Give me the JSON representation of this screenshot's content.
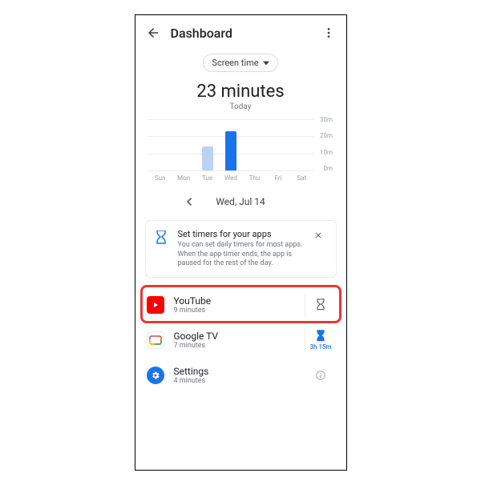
{
  "header": {
    "title": "Dashboard"
  },
  "dropdown": {
    "label": "Screen time"
  },
  "summary": {
    "total": "23 minutes",
    "period": "Today"
  },
  "date_nav": {
    "label": "Wed, Jul 14"
  },
  "info_card": {
    "title": "Set timers for your apps",
    "body": "You can set daily timers for most apps. When the app timer ends, the app is paused for the rest of the day."
  },
  "apps": [
    {
      "name": "YouTube",
      "usage": "9 minutes",
      "limit": "",
      "highlighted": true,
      "timer_icon": "hourglass",
      "timer_active": false
    },
    {
      "name": "Google TV",
      "usage": "7 minutes",
      "limit": "3h 15m",
      "highlighted": false,
      "timer_icon": "hourglass",
      "timer_active": true
    },
    {
      "name": "Settings",
      "usage": "4 minutes",
      "limit": "",
      "highlighted": false,
      "timer_icon": "info",
      "timer_active": false
    }
  ],
  "chart_data": {
    "type": "bar",
    "categories": [
      "Sun",
      "Mon",
      "Tue",
      "Wed",
      "Thu",
      "Fri",
      "Sat"
    ],
    "values": [
      0,
      0,
      14,
      23,
      0,
      0,
      0
    ],
    "selected_index": 3,
    "title": "",
    "xlabel": "",
    "ylabel": "",
    "ylim": [
      0,
      30
    ],
    "yticks": [
      "30m",
      "20m",
      "10m",
      "0m"
    ]
  },
  "colors": {
    "accent_blue": "#1a73e8",
    "highlight_red": "#e53935",
    "youtube_red": "#ff0000",
    "text_primary": "#202124",
    "text_secondary": "#70757a"
  }
}
